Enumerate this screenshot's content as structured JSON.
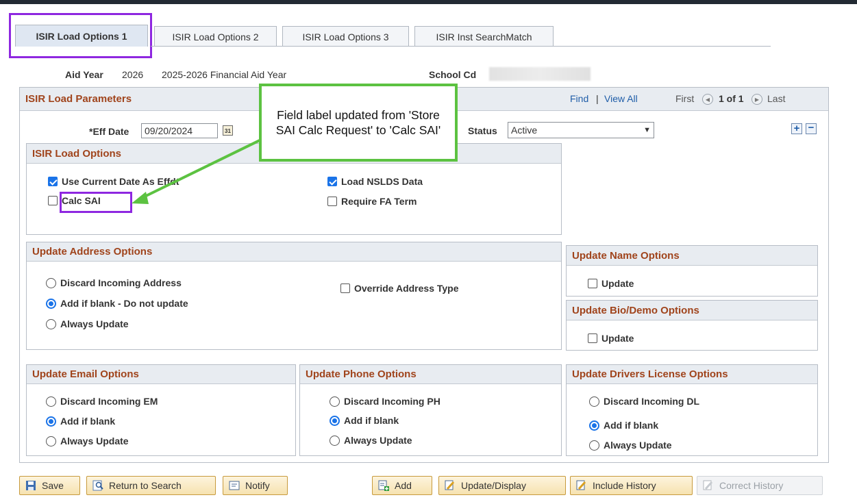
{
  "tabs": [
    {
      "label": "ISIR Load Options 1",
      "active": true
    },
    {
      "label": "ISIR Load Options 2",
      "active": false
    },
    {
      "label": "ISIR Load Options 3",
      "active": false
    },
    {
      "label": "ISIR Inst SearchMatch",
      "active": false
    }
  ],
  "header": {
    "aid_year_label": "Aid Year",
    "aid_year_value": "2026",
    "aid_year_desc": "2025-2026 Financial Aid Year",
    "school_cd_label": "School Cd"
  },
  "params": {
    "title": "ISIR Load Parameters",
    "find": "Find",
    "separator": "|",
    "view_all": "View All",
    "first": "First",
    "count": "1 of 1",
    "last": "Last",
    "eff_date_label": "*Eff Date",
    "eff_date_value": "09/20/2024",
    "status_label": "Status",
    "status_value": "Active"
  },
  "callout": {
    "text": "Field label updated from 'Store SAI Calc Request' to 'Calc SAI'"
  },
  "load_options": {
    "title": "ISIR Load Options",
    "use_current_date": "Use Current Date As Effdt",
    "calc_sai": "Calc SAI",
    "load_nslds": "Load NSLDS Data",
    "require_fa_term": "Require FA Term"
  },
  "address": {
    "title": "Update Address Options",
    "discard": "Discard Incoming Address",
    "add_if_blank": "Add if blank - Do not update",
    "always": "Always Update",
    "override": "Override Address Type"
  },
  "name_opts": {
    "title": "Update Name Options",
    "update": "Update"
  },
  "bio_opts": {
    "title": "Update Bio/Demo Options",
    "update": "Update"
  },
  "email": {
    "title": "Update Email Options",
    "discard": "Discard Incoming EM",
    "add": "Add if blank",
    "always": "Always Update"
  },
  "phone": {
    "title": "Update Phone Options",
    "discard": "Discard Incoming PH",
    "add": "Add if blank",
    "always": "Always Update"
  },
  "dl": {
    "title": "Update Drivers License Options",
    "discard": "Discard Incoming DL",
    "add": "Add if blank",
    "always": "Always Update"
  },
  "buttons": {
    "save": "Save",
    "return": "Return to Search",
    "notify": "Notify",
    "add": "Add",
    "update_display": "Update/Display",
    "include_history": "Include History",
    "correct_history": "Correct History"
  },
  "colors": {
    "accent_purple": "#8e27e0",
    "callout_green": "#5cc241",
    "section_title": "#a0441c"
  }
}
